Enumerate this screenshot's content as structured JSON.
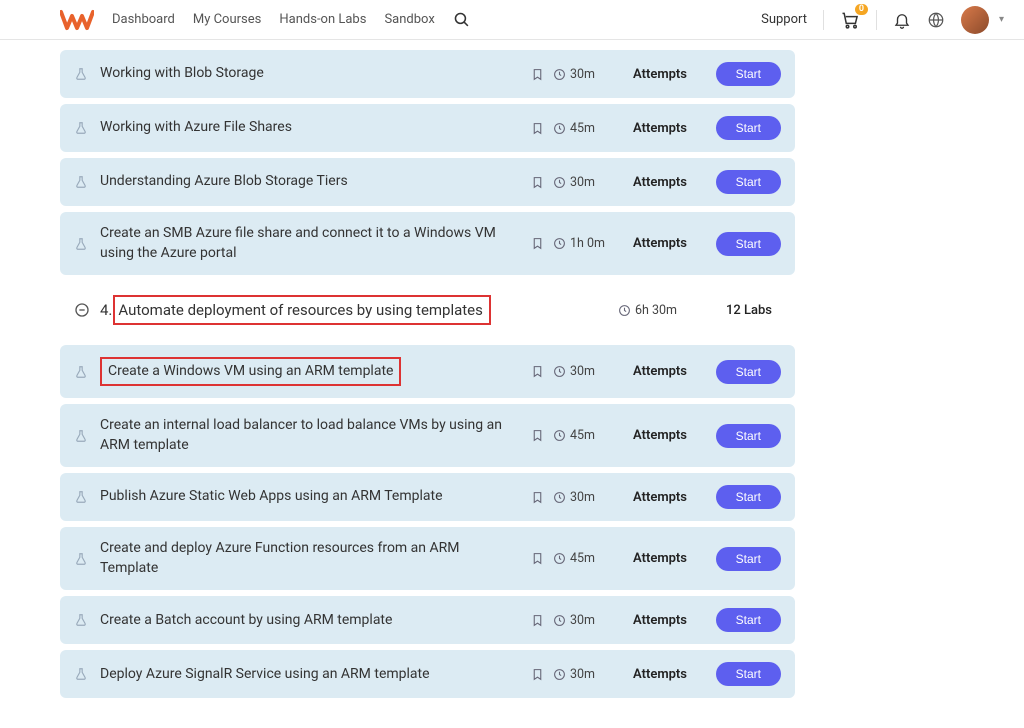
{
  "header": {
    "nav": [
      "Dashboard",
      "My Courses",
      "Hands-on Labs",
      "Sandbox"
    ],
    "support": "Support",
    "cart_badge": "0"
  },
  "rows_top": [
    {
      "title": "Working with Blob Storage",
      "time": "30m",
      "attempts": "Attempts",
      "start": "Start"
    },
    {
      "title": "Working with Azure File Shares",
      "time": "45m",
      "attempts": "Attempts",
      "start": "Start"
    },
    {
      "title": "Understanding Azure Blob Storage Tiers",
      "time": "30m",
      "attempts": "Attempts",
      "start": "Start"
    },
    {
      "title": "Create an SMB Azure file share and connect it to a Windows VM using the Azure portal",
      "time": "1h 0m",
      "attempts": "Attempts",
      "start": "Start"
    }
  ],
  "section": {
    "num": "4.",
    "title": "Automate deployment of resources by using templates",
    "time": "6h 30m",
    "labs": "12 Labs"
  },
  "rows_bottom": [
    {
      "title": "Create a Windows VM using an ARM template",
      "time": "30m",
      "attempts": "Attempts",
      "start": "Start",
      "highlight": true
    },
    {
      "title": "Create an internal load balancer to load balance VMs by using an ARM template",
      "time": "45m",
      "attempts": "Attempts",
      "start": "Start"
    },
    {
      "title": "Publish Azure Static Web Apps using an ARM Template",
      "time": "30m",
      "attempts": "Attempts",
      "start": "Start"
    },
    {
      "title": "Create and deploy Azure Function resources from an ARM Template",
      "time": "45m",
      "attempts": "Attempts",
      "start": "Start"
    },
    {
      "title": "Create a Batch account by using ARM template",
      "time": "30m",
      "attempts": "Attempts",
      "start": "Start"
    },
    {
      "title": "Deploy Azure SignalR Service using an ARM template",
      "time": "30m",
      "attempts": "Attempts",
      "start": "Start"
    }
  ]
}
